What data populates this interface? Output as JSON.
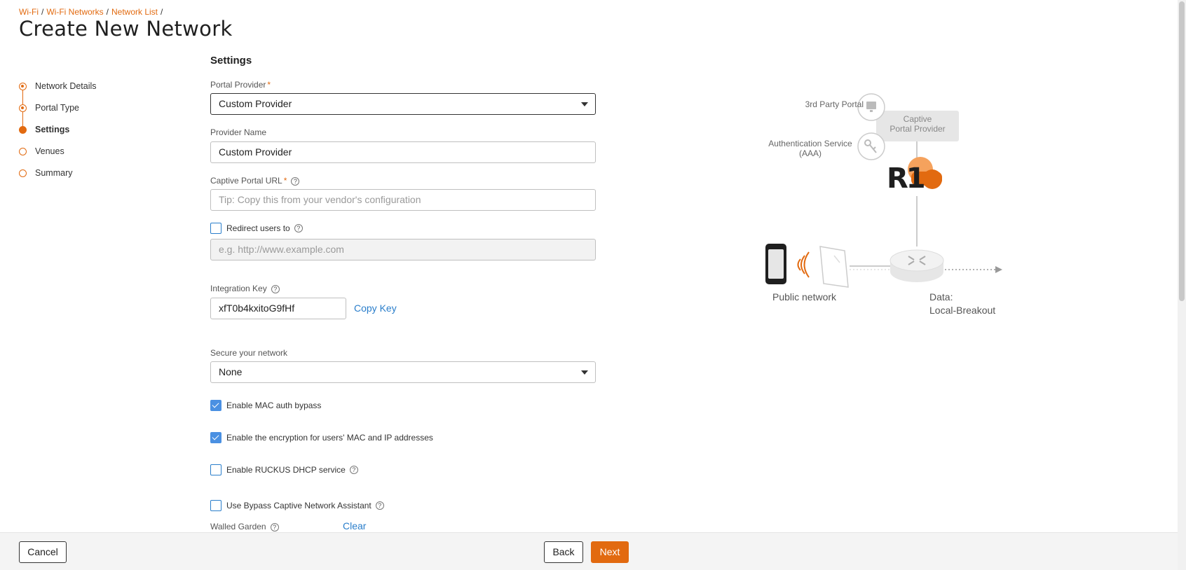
{
  "breadcrumb": {
    "items": [
      "Wi-Fi",
      "Wi-Fi Networks",
      "Network List"
    ],
    "separator": "/"
  },
  "page": {
    "title": "Create New Network"
  },
  "stepper": {
    "steps": [
      {
        "label": "Network Details",
        "state": "done"
      },
      {
        "label": "Portal Type",
        "state": "done"
      },
      {
        "label": "Settings",
        "state": "active"
      },
      {
        "label": "Venues",
        "state": "pending"
      },
      {
        "label": "Summary",
        "state": "pending"
      }
    ]
  },
  "settings": {
    "title": "Settings",
    "portal_provider": {
      "label": "Portal Provider",
      "required_mark": "*",
      "value": "Custom Provider"
    },
    "provider_name": {
      "label": "Provider Name",
      "value": "Custom Provider"
    },
    "captive_portal_url": {
      "label": "Captive Portal URL",
      "required_mark": "*",
      "placeholder": "Tip: Copy this from your vendor's configuration"
    },
    "redirect": {
      "label": "Redirect users to",
      "checked": false,
      "placeholder": "e.g. http://www.example.com"
    },
    "integration_key": {
      "label": "Integration Key",
      "value": "xfT0b4kxitoG9fHf",
      "copy_label": "Copy Key"
    },
    "secure_network": {
      "label": "Secure your network",
      "value": "None"
    },
    "mac_auth_bypass": {
      "label": "Enable MAC auth bypass",
      "checked": true
    },
    "encryption": {
      "label": "Enable the encryption for users' MAC and IP addresses",
      "checked": true
    },
    "dhcp": {
      "label": "Enable RUCKUS DHCP service",
      "checked": false
    },
    "bypass_cna": {
      "label": "Use Bypass Captive Network Assistant",
      "checked": false
    },
    "walled_garden": {
      "label": "Walled Garden",
      "clear_label": "Clear"
    },
    "help_glyph": "?"
  },
  "diagram": {
    "third_party_portal": "3rd Party Portal",
    "auth_service_line1": "Authentication Service",
    "auth_service_line2": "(AAA)",
    "captive_line1": "Captive",
    "captive_line2": "Portal Provider",
    "logo_text": "R1",
    "public_network": "Public network",
    "data_line1": "Data:",
    "data_line2": "Local-Breakout"
  },
  "footer": {
    "cancel": "Cancel",
    "back": "Back",
    "next": "Next"
  },
  "colors": {
    "accent": "#e26a10",
    "link": "#2a7ecb",
    "checkbox": "#4a90e2"
  }
}
